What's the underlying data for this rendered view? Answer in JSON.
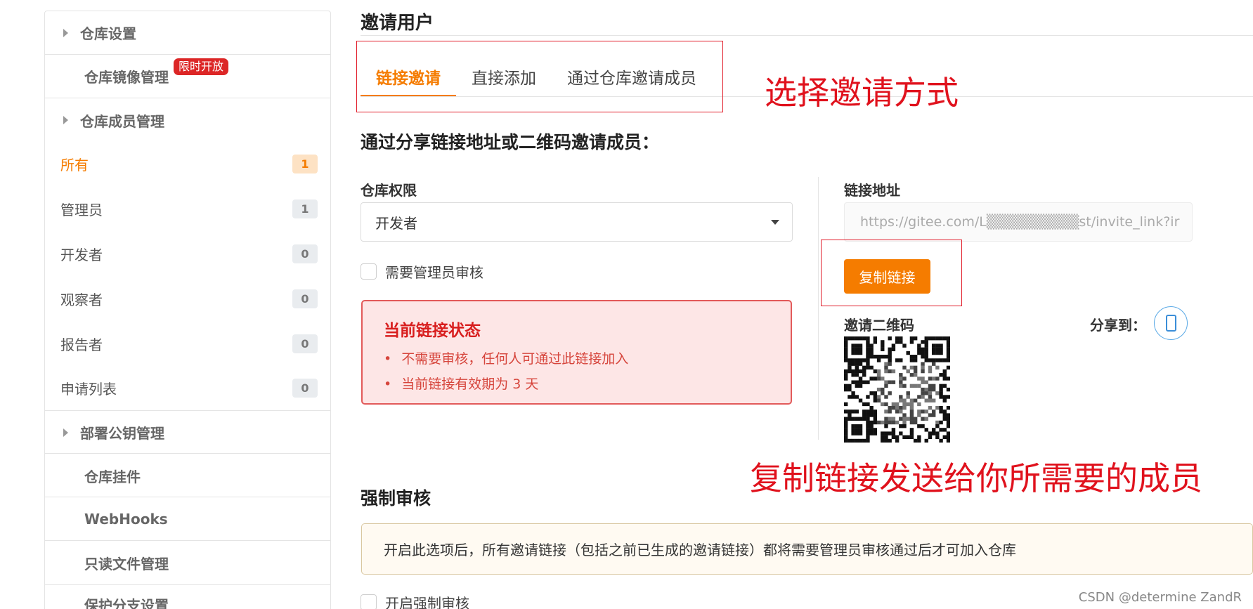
{
  "sidebar": {
    "warehouse_settings": "仓库设置",
    "mirror_manage": "仓库镜像管理",
    "limited_badge": "限时开放",
    "members_manage": "仓库成员管理",
    "roles": [
      {
        "label": "所有",
        "count": "1"
      },
      {
        "label": "管理员",
        "count": "1"
      },
      {
        "label": "开发者",
        "count": "0"
      },
      {
        "label": "观察者",
        "count": "0"
      },
      {
        "label": "报告者",
        "count": "0"
      },
      {
        "label": "申请列表",
        "count": "0"
      }
    ],
    "deploy_keys": "部署公钥管理",
    "plugins": "仓库挂件",
    "webhooks": "WebHooks",
    "readonly_files": "只读文件管理",
    "protected_branch": "保护分支设置"
  },
  "main": {
    "title": "邀请用户",
    "tabs": [
      {
        "label": "链接邀请"
      },
      {
        "label": "直接添加"
      },
      {
        "label": "通过仓库邀请成员"
      }
    ],
    "subtitle": "通过分享链接地址或二维码邀请成员：",
    "permission_label": "仓库权限",
    "permission_value": "开发者",
    "need_approval": "需要管理员审核",
    "status": {
      "title": "当前链接状态",
      "items": [
        "不需要审核，任何人可通过此链接加入",
        "当前链接有效期为 3 天"
      ]
    },
    "link_label": "链接地址",
    "link_value": "https://gitee.com/L▒▒▒▒▒▒▒▒▒st/invite_link?ir",
    "copy_button": "复制链接",
    "qr_label": "邀请二维码",
    "share_to": "分享到：",
    "force_section": "强制审核",
    "force_notice": "开启此选项后，所有邀请链接（包括之前已生成的邀请链接）都将需要管理员审核通过后才可加入仓库",
    "force_checkbox": "开启强制审核"
  },
  "annotations": {
    "choose_method": "选择邀请方式",
    "copy_and_send": "复制链接发送给你所需要的成员"
  },
  "watermark": "CSDN @determine  ZandR",
  "colors": {
    "accent": "#f57c00",
    "annotation": "#e0121d"
  }
}
